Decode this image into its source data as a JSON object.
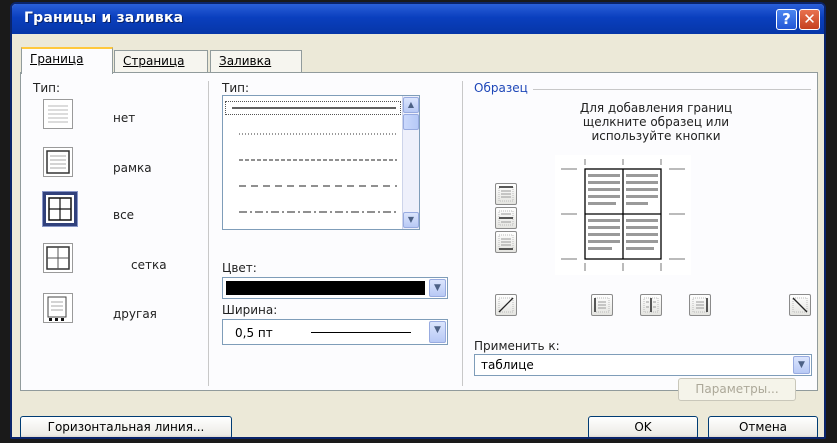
{
  "dialog": {
    "title": "Границы и заливка"
  },
  "title_buttons": {
    "help": "?",
    "close": "✕"
  },
  "tabs": [
    {
      "label": "Граница",
      "active": true
    },
    {
      "label": "Страница",
      "active": false
    },
    {
      "label": "Заливка",
      "active": false
    }
  ],
  "setting": {
    "label": "Тип:",
    "items": [
      {
        "label": "нет",
        "selected": false
      },
      {
        "label": "рамка",
        "selected": false
      },
      {
        "label": "все",
        "selected": true
      },
      {
        "label": "сетка",
        "selected": false
      },
      {
        "label": "другая",
        "selected": false
      }
    ]
  },
  "style": {
    "label": "Тип:",
    "color_label": "Цвет:",
    "color_value": "#000000",
    "width_label": "Ширина:",
    "width_value": "0,5 пт"
  },
  "preview": {
    "group_label": "Образец",
    "hint_line1": "Для добавления границ",
    "hint_line2": "щелкните образец или",
    "hint_line3": "используйте кнопки",
    "apply_label": "Применить к:",
    "apply_value": "таблице",
    "options_button": "Параметры..."
  },
  "footer": {
    "horizontal_line_button": "Горизонтальная линия...",
    "ok_button": "OK",
    "cancel_button": "Отмена"
  },
  "colors": {
    "titlebar": "#0a3fbe",
    "dialog_bg": "#ece9d8",
    "active_tab_accent": "#ffc83c",
    "group_title": "#1e47b8"
  }
}
